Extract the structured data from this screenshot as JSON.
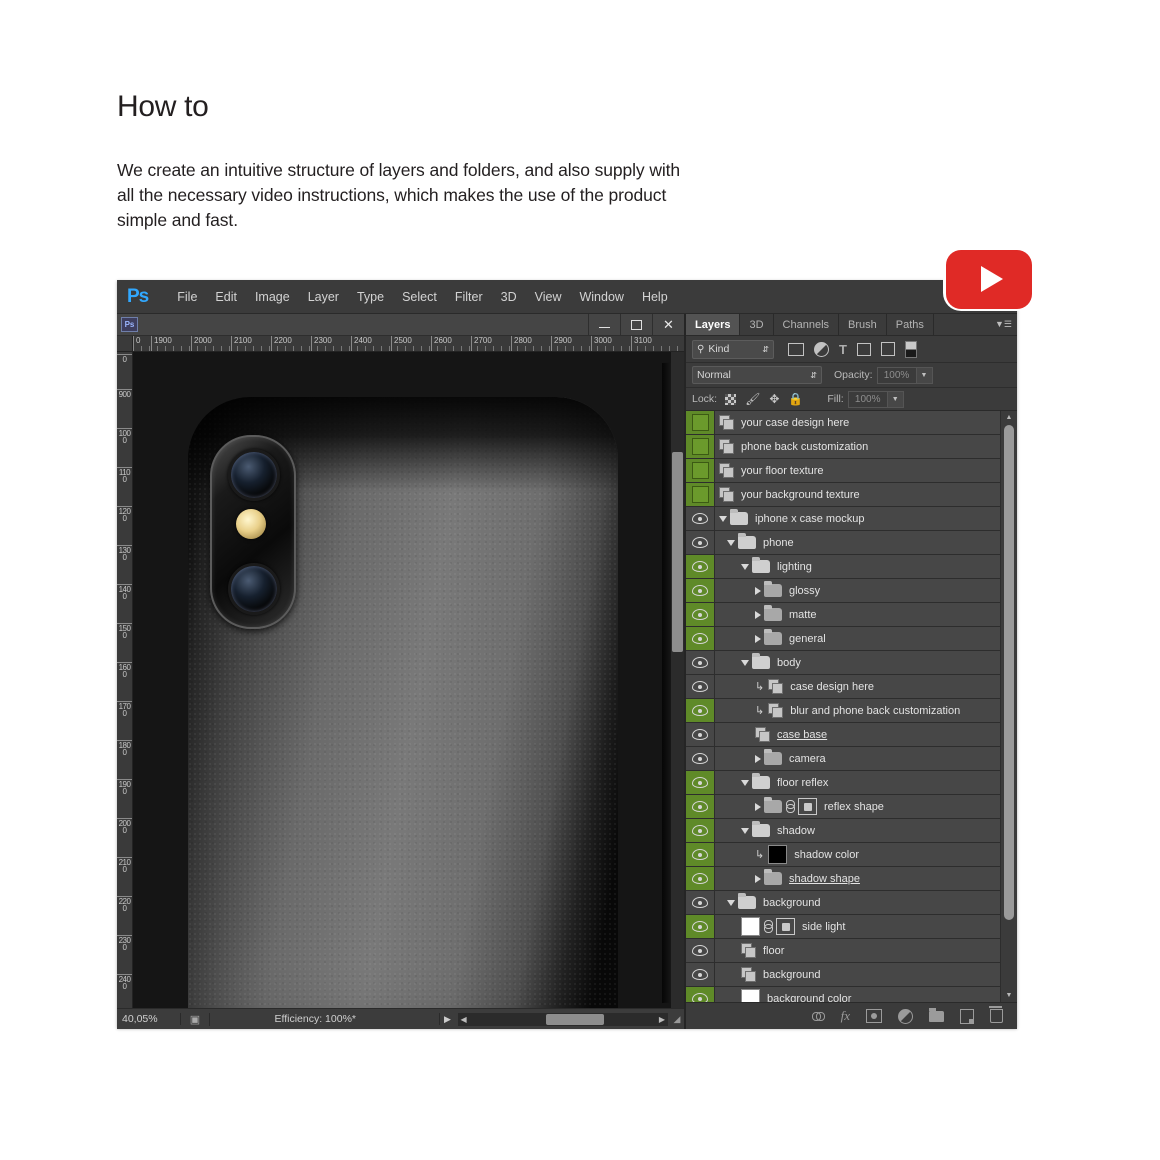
{
  "intro": {
    "title": "How to",
    "body": "We create an intuitive structure of layers and folders, and also supply with all the necessary video instructions, which makes the use of the product simple and fast."
  },
  "youtube": {
    "icon": "play-triangle-icon",
    "brand_color": "#e02a26"
  },
  "photoshop": {
    "logo": "Ps",
    "menu": [
      "File",
      "Edit",
      "Image",
      "Layer",
      "Type",
      "Select",
      "Filter",
      "3D",
      "View",
      "Window",
      "Help"
    ],
    "document": {
      "window_icon": "Ps",
      "window_controls": [
        "minimize",
        "maximize",
        "close"
      ],
      "ruler_h_ticks": [
        "0",
        "1900",
        "2000",
        "2100",
        "2200",
        "2300",
        "2400",
        "2500",
        "2600",
        "2700",
        "2800",
        "2900",
        "3000",
        "3100"
      ],
      "ruler_v_ticks": [
        "0",
        "900",
        "1000",
        "1100",
        "1200",
        "1300",
        "1400",
        "1500",
        "1600",
        "1700",
        "1800",
        "1900",
        "2000",
        "2100",
        "2200",
        "2300",
        "2400"
      ],
      "status": {
        "zoom": "40,05%",
        "efficiency": "Efficiency: 100%*"
      }
    },
    "panel": {
      "tabs": [
        {
          "label": "Layers",
          "active": true
        },
        {
          "label": "3D",
          "active": false
        },
        {
          "label": "Channels",
          "active": false
        },
        {
          "label": "Brush",
          "active": false
        },
        {
          "label": "Paths",
          "active": false
        }
      ],
      "filter": {
        "kind_label": "Kind",
        "icons": [
          "pixel-layer-filter-icon",
          "adjustment-layer-filter-icon",
          "type-layer-filter-icon",
          "shape-layer-filter-icon",
          "smart-object-filter-icon",
          "filter-toggle-icon"
        ]
      },
      "blend": {
        "mode": "Normal",
        "opacity_label": "Opacity:",
        "opacity_value": "100%"
      },
      "lock": {
        "label": "Lock:",
        "icons": [
          "lock-transparent-pixels-icon",
          "lock-image-pixels-icon",
          "lock-position-icon",
          "lock-all-icon"
        ],
        "fill_label": "Fill:",
        "fill_value": "100%"
      },
      "layers": [
        {
          "name": "your case design here",
          "indent": 0,
          "green": true,
          "marker": "square",
          "icon": "smart",
          "twirl": "none"
        },
        {
          "name": "phone back customization",
          "indent": 0,
          "green": true,
          "marker": "square",
          "icon": "smart",
          "twirl": "none"
        },
        {
          "name": "your floor texture",
          "indent": 0,
          "green": true,
          "marker": "square",
          "icon": "smart",
          "twirl": "none"
        },
        {
          "name": "your background texture",
          "indent": 0,
          "green": true,
          "marker": "square",
          "icon": "smart",
          "twirl": "none"
        },
        {
          "name": "iphone x case mockup",
          "indent": 0,
          "green": false,
          "marker": "eye",
          "icon": "folder-open",
          "twirl": "down"
        },
        {
          "name": "phone",
          "indent": 1,
          "green": false,
          "marker": "eye",
          "icon": "folder-open",
          "twirl": "down"
        },
        {
          "name": "lighting",
          "indent": 2,
          "green": true,
          "marker": "eye",
          "icon": "folder-open",
          "twirl": "down"
        },
        {
          "name": "glossy",
          "indent": 3,
          "green": true,
          "marker": "eye",
          "icon": "folder-closed",
          "twirl": "right"
        },
        {
          "name": "matte",
          "indent": 3,
          "green": true,
          "marker": "eye",
          "icon": "folder-closed",
          "twirl": "right"
        },
        {
          "name": "general",
          "indent": 3,
          "green": true,
          "marker": "eye",
          "icon": "folder-closed",
          "twirl": "right"
        },
        {
          "name": "body",
          "indent": 2,
          "green": false,
          "marker": "eye",
          "icon": "folder-open",
          "twirl": "down"
        },
        {
          "name": "case design here",
          "indent": 3,
          "green": false,
          "marker": "eye",
          "icon": "smart",
          "twirl": "none",
          "clipped": true
        },
        {
          "name": "blur and phone back customization",
          "indent": 3,
          "green": true,
          "marker": "eye",
          "icon": "smart",
          "twirl": "none",
          "clipped": true
        },
        {
          "name": "case base ",
          "indent": 3,
          "green": false,
          "marker": "eye",
          "icon": "smart",
          "twirl": "none",
          "renaming": true
        },
        {
          "name": "camera",
          "indent": 3,
          "green": false,
          "marker": "eye",
          "icon": "folder-closed",
          "twirl": "right"
        },
        {
          "name": "floor reflex",
          "indent": 2,
          "green": true,
          "marker": "eye",
          "icon": "folder-open",
          "twirl": "down"
        },
        {
          "name": "reflex shape",
          "indent": 3,
          "green": true,
          "marker": "eye",
          "icon": "folder-closed",
          "twirl": "right",
          "link": true,
          "mask": true
        },
        {
          "name": "shadow",
          "indent": 2,
          "green": true,
          "marker": "eye",
          "icon": "folder-open",
          "twirl": "down"
        },
        {
          "name": "shadow color",
          "indent": 3,
          "green": true,
          "marker": "eye",
          "icon": "swatch-black",
          "twirl": "none",
          "clipped": true
        },
        {
          "name": "shadow shape ",
          "indent": 3,
          "green": true,
          "marker": "eye",
          "icon": "folder-closed",
          "twirl": "right",
          "renaming": true
        },
        {
          "name": "background",
          "indent": 1,
          "green": false,
          "marker": "eye",
          "icon": "folder-open",
          "twirl": "down"
        },
        {
          "name": "side light",
          "indent": 2,
          "green": true,
          "marker": "eye",
          "icon": "swatch-white",
          "twirl": "none",
          "link": true,
          "mask": true
        },
        {
          "name": "floor",
          "indent": 2,
          "green": false,
          "marker": "eye",
          "icon": "smart",
          "twirl": "none"
        },
        {
          "name": "background",
          "indent": 2,
          "green": false,
          "marker": "eye",
          "icon": "smart",
          "twirl": "none"
        },
        {
          "name": "background color",
          "indent": 2,
          "green": true,
          "marker": "eye",
          "icon": "swatch-white",
          "twirl": "none"
        }
      ],
      "footer_icons": [
        "link-layers-icon",
        "layer-style-fx-icon",
        "add-layer-mask-icon",
        "new-adjustment-layer-icon",
        "new-group-icon",
        "new-layer-icon",
        "delete-layer-icon"
      ]
    }
  }
}
